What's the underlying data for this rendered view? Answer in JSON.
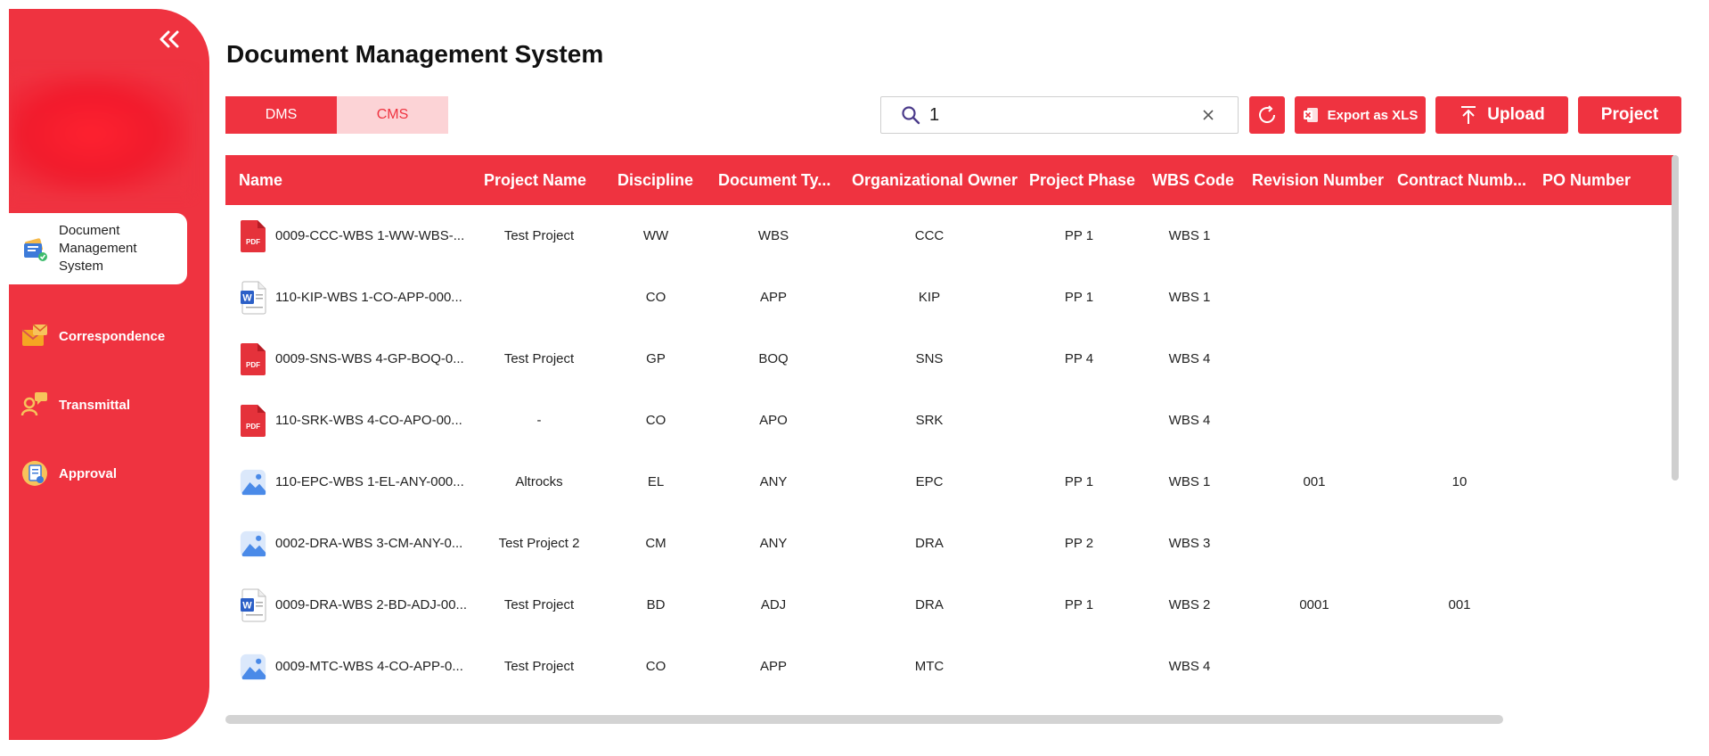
{
  "app": {
    "title": "Document Management System"
  },
  "sidebar": {
    "items": [
      {
        "label": "Document Management System",
        "icon": "document-management-icon",
        "active": true
      },
      {
        "label": "Correspondence",
        "icon": "correspondence-icon"
      },
      {
        "label": "Transmittal",
        "icon": "transmittal-icon"
      },
      {
        "label": "Approval",
        "icon": "approval-icon"
      }
    ]
  },
  "tabs": [
    {
      "label": "DMS",
      "active": true
    },
    {
      "label": "CMS",
      "active": false
    }
  ],
  "search": {
    "value": "1",
    "placeholder": ""
  },
  "toolbar": {
    "export_label": "Export as XLS",
    "upload_label": "Upload",
    "project_label": "Project"
  },
  "table": {
    "columns": [
      "Name",
      "Project Name",
      "Discipline",
      "Document Ty...",
      "Organizational Owner",
      "Project Phase",
      "WBS Code",
      "Revision Number",
      "Contract Numb...",
      "PO Number"
    ],
    "rows": [
      {
        "type": "pdf",
        "name": "0009-CCC-WBS 1-WW-WBS-...",
        "project": "Test Project",
        "discipline": "WW",
        "doctype": "WBS",
        "owner": "CCC",
        "phase": "PP 1",
        "wbs": "WBS 1",
        "revision": "",
        "contract": "",
        "po": ""
      },
      {
        "type": "word",
        "name": "110-KIP-WBS 1-CO-APP-000...",
        "project": "",
        "discipline": "CO",
        "doctype": "APP",
        "owner": "KIP",
        "phase": "PP 1",
        "wbs": "WBS 1",
        "revision": "",
        "contract": "",
        "po": ""
      },
      {
        "type": "pdf",
        "name": "0009-SNS-WBS 4-GP-BOQ-0...",
        "project": "Test Project",
        "discipline": "GP",
        "doctype": "BOQ",
        "owner": "SNS",
        "phase": "PP 4",
        "wbs": "WBS 4",
        "revision": "",
        "contract": "",
        "po": ""
      },
      {
        "type": "pdf",
        "name": "110-SRK-WBS 4-CO-APO-00...",
        "project": "-",
        "discipline": "CO",
        "doctype": "APO",
        "owner": "SRK",
        "phase": "",
        "wbs": "WBS 4",
        "revision": "",
        "contract": "",
        "po": ""
      },
      {
        "type": "image",
        "name": "110-EPC-WBS 1-EL-ANY-000...",
        "project": "Altrocks",
        "discipline": "EL",
        "doctype": "ANY",
        "owner": "EPC",
        "phase": "PP 1",
        "wbs": "WBS 1",
        "revision": "001",
        "contract": "10",
        "po": ""
      },
      {
        "type": "image",
        "name": "0002-DRA-WBS 3-CM-ANY-0...",
        "project": "Test Project 2",
        "discipline": "CM",
        "doctype": "ANY",
        "owner": "DRA",
        "phase": "PP 2",
        "wbs": "WBS 3",
        "revision": "",
        "contract": "",
        "po": ""
      },
      {
        "type": "word",
        "name": "0009-DRA-WBS 2-BD-ADJ-00...",
        "project": "Test Project",
        "discipline": "BD",
        "doctype": "ADJ",
        "owner": "DRA",
        "phase": "PP 1",
        "wbs": "WBS 2",
        "revision": "0001",
        "contract": "001",
        "po": ""
      },
      {
        "type": "image",
        "name": "0009-MTC-WBS 4-CO-APP-0...",
        "project": "Test Project",
        "discipline": "CO",
        "doctype": "APP",
        "owner": "MTC",
        "phase": "",
        "wbs": "WBS 4",
        "revision": "",
        "contract": "",
        "po": ""
      }
    ]
  },
  "colors": {
    "accent": "#ef3340",
    "accent_light": "#fcd3d6"
  }
}
